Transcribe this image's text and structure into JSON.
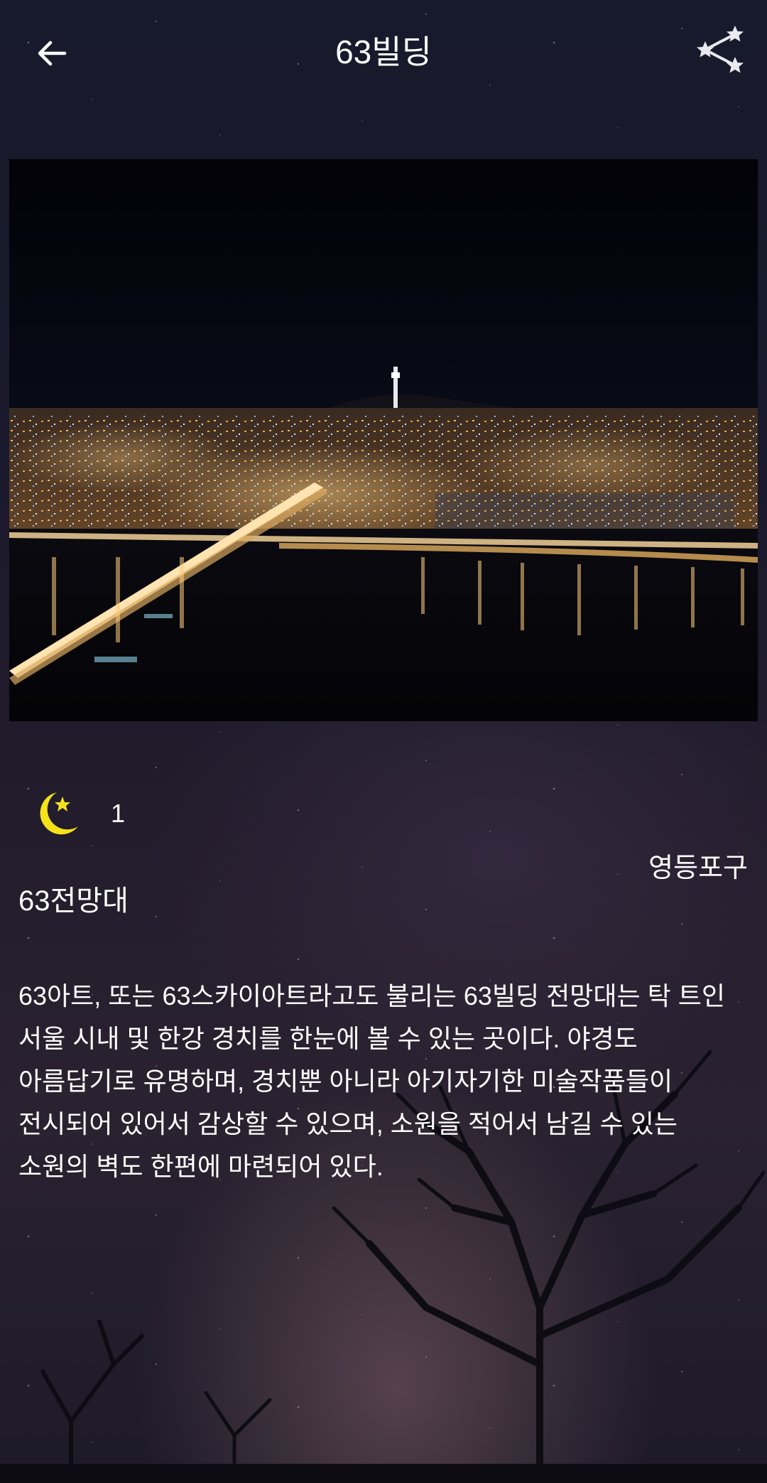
{
  "header": {
    "title": "63빌딩",
    "back_icon": "arrow-left-icon",
    "share_icon": "share-icon"
  },
  "photo": {
    "subject": "night-city-photo",
    "accent_colors": [
      "#ffb347",
      "#6fa8ff",
      "#ffffff"
    ]
  },
  "rating": {
    "icon": "moon-star-icon",
    "icon_color": "#f5e21b",
    "count": "1"
  },
  "location": {
    "area": "영등포구",
    "name": "63전망대"
  },
  "description": {
    "lines": [
      "63아트, 또는 63스카이아트라고도 불리는 63빌딩 전망대는 탁 트인",
      "서울 시내 및 한강 경치를 한눈에 볼 수 있는 곳이다. 야경도",
      "아름답기로 유명하며, 경치뿐 아니라 아기자기한 미술작품들이",
      "전시되어 있어서 감상할 수 있으며, 소원을 적어서 남길 수 있는",
      "소원의 벽도 한편에 마련되어 있다."
    ]
  }
}
